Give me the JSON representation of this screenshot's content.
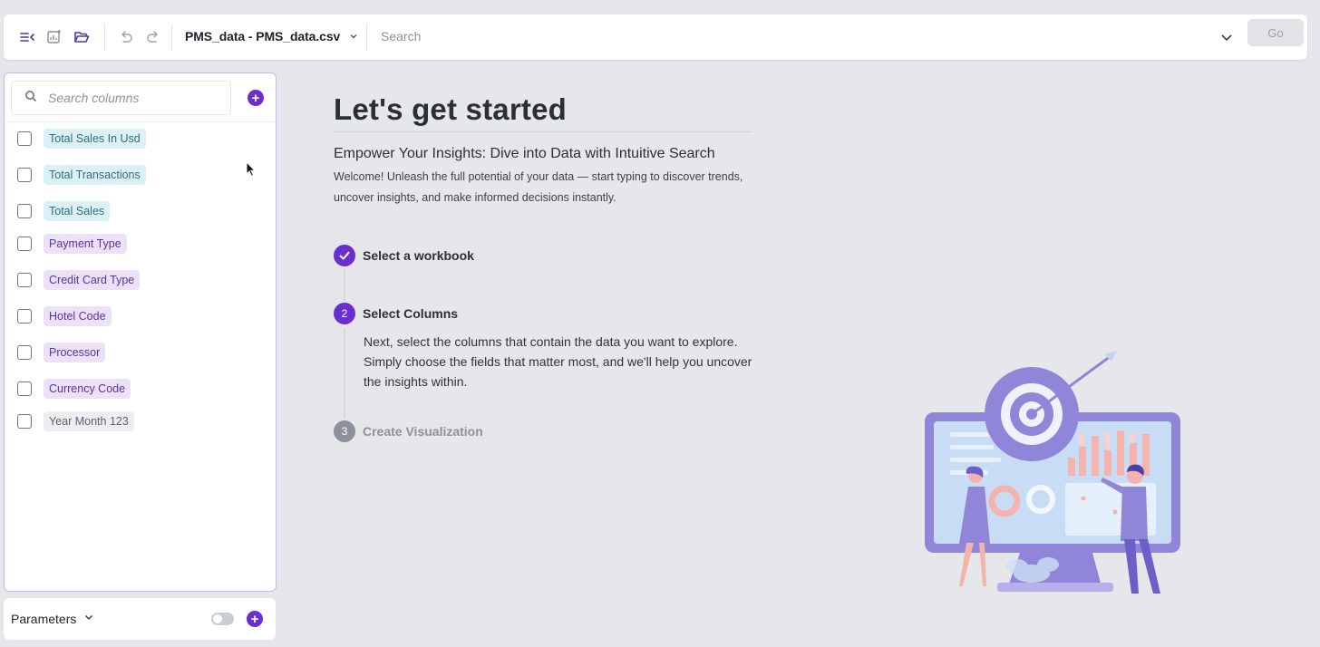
{
  "toolbar": {
    "file_name": "PMS_data - PMS_data.csv",
    "search_placeholder": "Search",
    "go_label": "Go"
  },
  "sidebar": {
    "search_placeholder": "Search columns",
    "columns": [
      {
        "label": "Total Sales In Usd",
        "kind": "measure"
      },
      {
        "label": "Total Transactions",
        "kind": "measure"
      },
      {
        "label": "Total Sales",
        "kind": "measure"
      },
      {
        "label": "Payment Type",
        "kind": "attribute"
      },
      {
        "label": "Credit Card Type",
        "kind": "attribute"
      },
      {
        "label": "Hotel Code",
        "kind": "attribute"
      },
      {
        "label": "Processor",
        "kind": "attribute"
      },
      {
        "label": "Currency Code",
        "kind": "attribute"
      },
      {
        "label": "Year Month 123",
        "kind": "date"
      }
    ],
    "parameters_label": "Parameters"
  },
  "main": {
    "title": "Let's get started",
    "subtitle": "Empower Your Insights: Dive into Data with Intuitive Search",
    "welcome": "Welcome! Unleash the full potential of your data — start typing to discover trends, uncover insights, and make informed decisions instantly.",
    "steps": [
      {
        "number": "✓",
        "label": "Select a workbook",
        "state": "done"
      },
      {
        "number": "2",
        "label": "Select Columns",
        "state": "active",
        "description": "Next, select the columns that contain the data you want to explore. Simply choose the fields that matter most, and we'll help you uncover the insights within."
      },
      {
        "number": "3",
        "label": "Create Visualization",
        "state": "pending"
      }
    ]
  },
  "colors": {
    "accent": "#6a2fd1",
    "measure_chip_bg": "#dcf1f5",
    "attribute_chip_bg": "#ebe2f8",
    "pending": "#8d9199"
  },
  "icons": [
    "collapse-menu-icon",
    "add-chart-icon",
    "folder-open-icon",
    "undo-icon",
    "redo-icon",
    "chevron-down-icon",
    "search-icon",
    "plus-icon",
    "check-icon",
    "mouse-cursor-icon"
  ]
}
